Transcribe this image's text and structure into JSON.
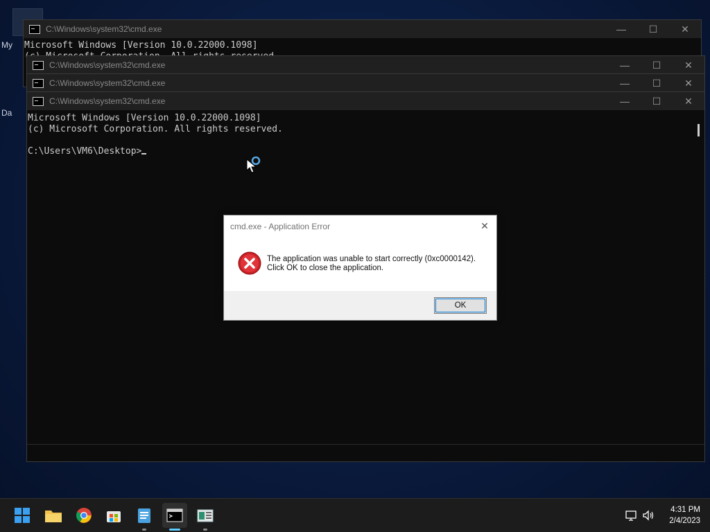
{
  "desktop": {
    "labels": [
      "My",
      "Da"
    ]
  },
  "windows": [
    {
      "title": "C:\\Windows\\system32\\cmd.exe",
      "lines": [
        "Microsoft Windows [Version 10.0.22000.1098]",
        "(c) Microsoft Corporation. All rights reserved."
      ]
    },
    {
      "title": "C:\\Windows\\system32\\cmd.exe"
    },
    {
      "title": "C:\\Windows\\system32\\cmd.exe"
    },
    {
      "title": "C:\\Windows\\system32\\cmd.exe",
      "lines": [
        "Microsoft Windows [Version 10.0.22000.1098]",
        "(c) Microsoft Corporation. All rights reserved.",
        "",
        "C:\\Users\\VM6\\Desktop>"
      ]
    }
  ],
  "controls": {
    "minimize": "—",
    "maximize": "☐",
    "close": "✕"
  },
  "dialog": {
    "title": "cmd.exe - Application Error",
    "message_line1": "The application was unable to start correctly (0xc0000142).",
    "message_line2": "Click OK to close the application.",
    "ok_label": "OK",
    "close_glyph": "✕",
    "icon": "error-icon"
  },
  "taskbar": {
    "apps": [
      "start-icon",
      "file-explorer-icon",
      "chrome-icon",
      "store-icon",
      "notepad-icon",
      "cmd-icon",
      "app-icon"
    ],
    "time": "4:31 PM",
    "date": "2/4/2023"
  },
  "colors": {
    "error_red": "#d6262b",
    "accent": "#60cdff",
    "dialog_focus": "#0078d7"
  }
}
